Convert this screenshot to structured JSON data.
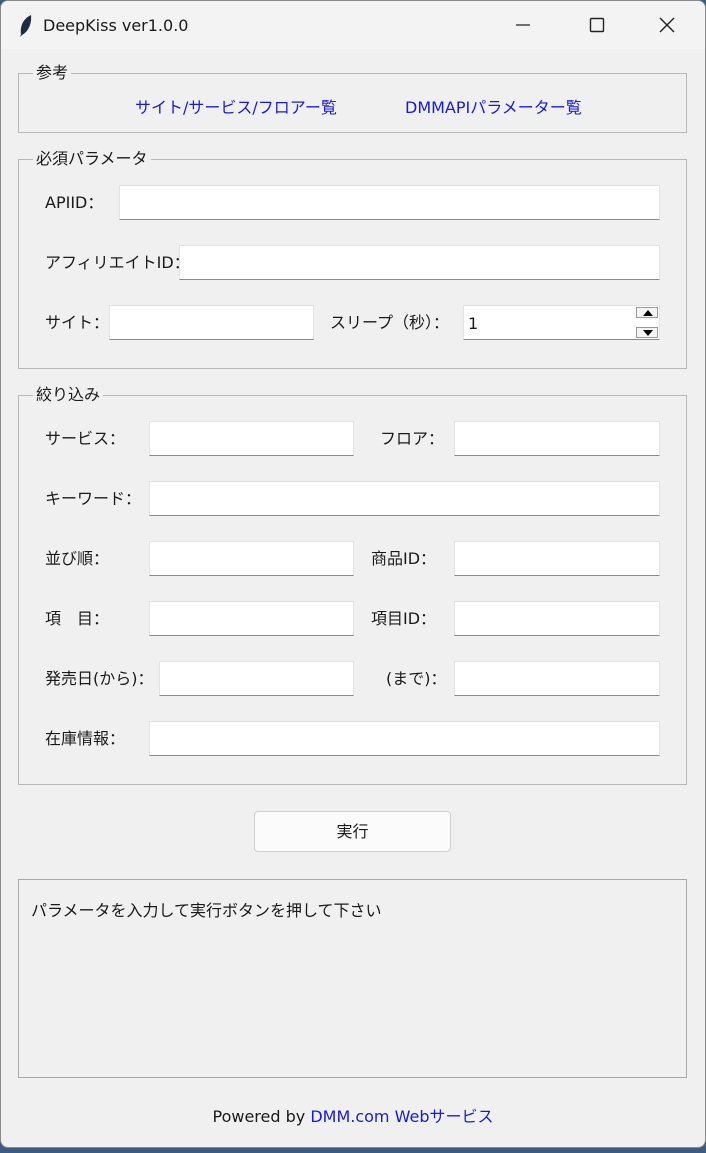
{
  "window": {
    "title": "DeepKiss ver1.0.0",
    "icon": "feather-icon"
  },
  "reference": {
    "legend": "参考",
    "link_sites": "サイト/サービス/フロアー覧",
    "link_params": "DMMAPIパラメーター覧"
  },
  "required": {
    "legend": "必須パラメータ",
    "api_id_label": "APIID：",
    "api_id_value": "",
    "affiliate_id_label": "アフィリエイトID：",
    "affiliate_id_value": "",
    "site_label": "サイト：",
    "site_value": "",
    "sleep_label": "スリープ（秒）：",
    "sleep_value": "1"
  },
  "filter": {
    "legend": "絞り込み",
    "service_label": "サービス：",
    "floor_label": "フロア：",
    "keyword_label": "キーワード：",
    "sort_label": "並び順：",
    "product_id_label": "商品ID：",
    "item_label": "項　目：",
    "item_id_label": "項目ID：",
    "release_from_label": "発売日(から)：",
    "release_to_label": "(まで)：",
    "stock_label": "在庫情報："
  },
  "actions": {
    "run_label": "実行"
  },
  "output": {
    "message": "パラメータを入力して実行ボタンを押して下さい"
  },
  "footer": {
    "prefix": "Powered by",
    "link": "DMM.com Webサービス"
  }
}
